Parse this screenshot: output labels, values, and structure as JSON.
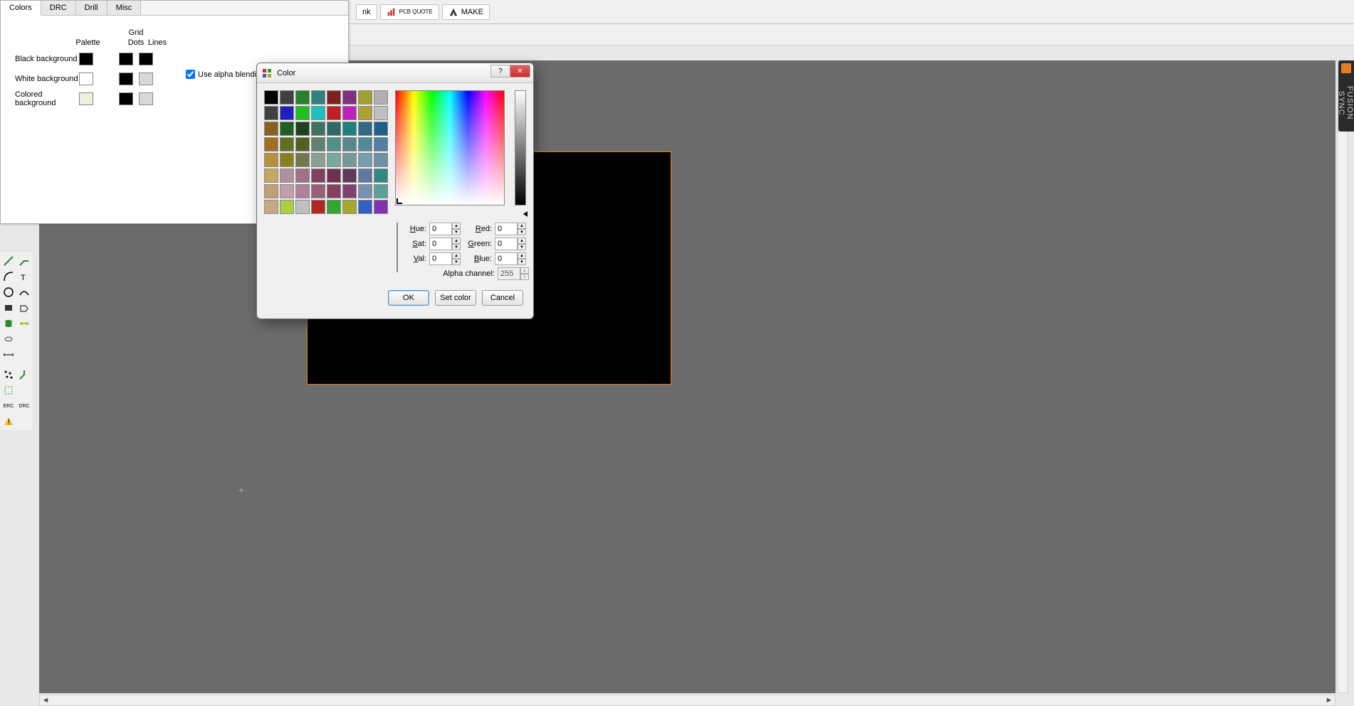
{
  "top_toolbar": {
    "ink": "nk",
    "pcb_quote": "PCB QUOTE",
    "make": "MAKE"
  },
  "fusion_tab": "FUSION SYNC",
  "settings": {
    "tabs": [
      "Colors",
      "DRC",
      "Drill",
      "Misc"
    ],
    "active_tab": "Colors",
    "palette_header": "Palette",
    "grid_header": "Grid",
    "dots_header": "Dots",
    "lines_header": "Lines",
    "rows": [
      {
        "label": "Black background",
        "palette": "#000000",
        "dots": "#000000",
        "lines": "#000000"
      },
      {
        "label": "White background",
        "palette": "#ffffff",
        "dots": "#000000",
        "lines": "#d8d8d8"
      },
      {
        "label": "Colored background",
        "palette": "#eeeedd",
        "dots": "#000000",
        "lines": "#d8d8d8"
      }
    ],
    "alpha_label": "Use alpha blending",
    "alpha_checked": true
  },
  "color_dialog": {
    "title": "Color",
    "palette": [
      "#000000",
      "#404040",
      "#288028",
      "#308080",
      "#802020",
      "#803080",
      "#a0a030",
      "#b0b0b0",
      "#404040",
      "#2020c0",
      "#20c020",
      "#20c0c0",
      "#c02020",
      "#c020c0",
      "#b0a030",
      "#c0c0c0",
      "#886020",
      "#206020",
      "#204020",
      "#407060",
      "#306868",
      "#208080",
      "#306888",
      "#206088",
      "#a07020",
      "#607020",
      "#506020",
      "#608070",
      "#509088",
      "#58888c",
      "#50889c",
      "#5080a0",
      "#b89040",
      "#888020",
      "#70784c",
      "#8aa090",
      "#78a8a0",
      "#789898",
      "#789cb0",
      "#6c90a4",
      "#c8a860",
      "#b090a0",
      "#a07088",
      "#804060",
      "#703050",
      "#603858",
      "#6078a0",
      "#308880",
      "#c0a078",
      "#c0a0a8",
      "#b08098",
      "#986078",
      "#884060",
      "#804070",
      "#7890b4",
      "#58a098",
      "#c8a880",
      "#a8d040",
      "#c0c0c0",
      "#b02820",
      "#30a830",
      "#a8a830",
      "#3060c0",
      "#8030b0"
    ],
    "hue_label": "Hue:",
    "hue_val": "0",
    "sat_label": "Sat:",
    "sat_val": "0",
    "val_label": "Val:",
    "val_val": "0",
    "red_label": "Red:",
    "red_val": "0",
    "green_label": "Green:",
    "green_val": "0",
    "blue_label": "Blue:",
    "blue_val": "0",
    "alpha_label": "Alpha channel:",
    "alpha_val": "255",
    "ok": "OK",
    "set_color": "Set color",
    "cancel": "Cancel"
  },
  "tool_labels": [
    "ERC",
    "DRC"
  ]
}
